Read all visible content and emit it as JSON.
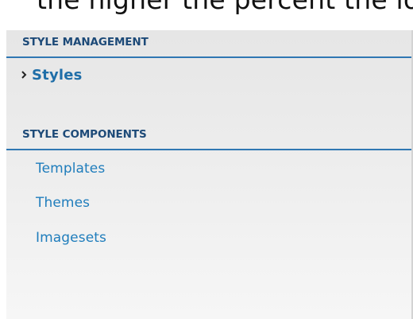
{
  "top_strip": {
    "clipped_text": "the higher the percent the lower the style"
  },
  "menu": {
    "sections": [
      {
        "header": "STYLE MANAGEMENT",
        "items": [
          {
            "label": "Styles",
            "active": true,
            "icon": "chevron-right-icon"
          }
        ]
      },
      {
        "header": "STYLE COMPONENTS",
        "items": [
          {
            "label": "Templates"
          },
          {
            "label": "Themes"
          },
          {
            "label": "Imagesets"
          }
        ]
      }
    ]
  },
  "colors": {
    "header_text": "#1d4a78",
    "header_rule": "#2f77b3",
    "link": "#1f7dbc",
    "active_link": "#1f6ea8"
  }
}
